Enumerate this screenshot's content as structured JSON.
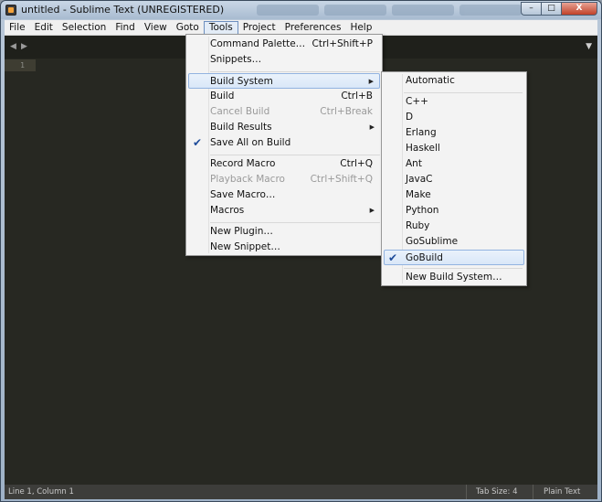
{
  "window": {
    "title": "untitled - Sublime Text (UNREGISTERED)",
    "buttons": {
      "minimize": "–",
      "maximize": "□",
      "close": "X"
    }
  },
  "menubar": [
    "File",
    "Edit",
    "Selection",
    "Find",
    "View",
    "Goto",
    "Tools",
    "Project",
    "Preferences",
    "Help"
  ],
  "active_menu": "Tools",
  "editor": {
    "line_numbers": [
      "1"
    ],
    "nav_back_icon": "triangle-left-icon",
    "nav_forward_icon": "triangle-right-icon",
    "tab_dropdown_icon": "triangle-down-icon"
  },
  "tools_menu": {
    "items": [
      {
        "label": "Command Palette…",
        "shortcut": "Ctrl+Shift+P"
      },
      {
        "label": "Snippets…",
        "shortcut": ""
      },
      {
        "label": "Build System",
        "shortcut": "",
        "submenu": true,
        "highlighted": true
      },
      {
        "label": "Build",
        "shortcut": "Ctrl+B"
      },
      {
        "label": "Cancel Build",
        "shortcut": "Ctrl+Break",
        "disabled": true
      },
      {
        "label": "Build Results",
        "shortcut": "",
        "submenu": true
      },
      {
        "label": "Save All on Build",
        "shortcut": "",
        "checked": true
      },
      {
        "label": "Record Macro",
        "shortcut": "Ctrl+Q"
      },
      {
        "label": "Playback Macro",
        "shortcut": "Ctrl+Shift+Q",
        "disabled": true
      },
      {
        "label": "Save Macro…",
        "shortcut": ""
      },
      {
        "label": "Macros",
        "shortcut": "",
        "submenu": true
      },
      {
        "label": "New Plugin…",
        "shortcut": ""
      },
      {
        "label": "New Snippet…",
        "shortcut": ""
      }
    ]
  },
  "build_system_menu": {
    "items": [
      {
        "label": "Automatic"
      },
      {
        "label": "C++"
      },
      {
        "label": "D"
      },
      {
        "label": "Erlang"
      },
      {
        "label": "Haskell"
      },
      {
        "label": "Ant"
      },
      {
        "label": "JavaC"
      },
      {
        "label": "Make"
      },
      {
        "label": "Python"
      },
      {
        "label": "Ruby"
      },
      {
        "label": "GoSublime"
      },
      {
        "label": "GoBuild",
        "checked": true,
        "highlighted": true
      },
      {
        "label": "New Build System…"
      }
    ]
  },
  "statusbar": {
    "position": "Line 1, Column 1",
    "tab_size": "Tab Size: 4",
    "syntax": "Plain Text"
  },
  "colors": {
    "editor_bg": "#272822",
    "gutter_text": "#8f908a",
    "menu_bg": "#f3f3f3",
    "menu_highlight": "#d9e7f8",
    "check": "#1e4c9a"
  }
}
